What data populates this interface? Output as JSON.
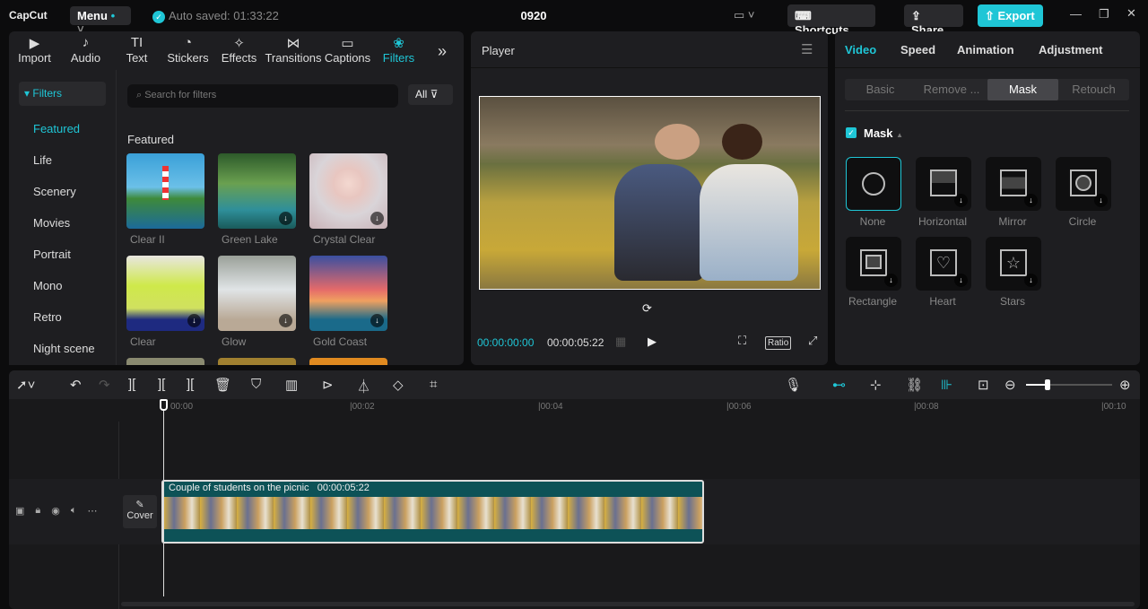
{
  "topbar": {
    "logo": "CapCut",
    "menu": "Menu",
    "autosave": "Auto saved: 01:33:22",
    "project": "0920",
    "shortcuts": "Shortcuts",
    "share": "Share",
    "export": "Export"
  },
  "media_tabs": [
    {
      "label": "Import",
      "icon": "▶"
    },
    {
      "label": "Audio",
      "icon": "♪"
    },
    {
      "label": "Text",
      "icon": "TI"
    },
    {
      "label": "Stickers",
      "icon": "◔"
    },
    {
      "label": "Effects",
      "icon": "✧"
    },
    {
      "label": "Transitions",
      "icon": "⋈"
    },
    {
      "label": "Captions",
      "icon": "▭"
    },
    {
      "label": "Filters",
      "icon": "❀"
    }
  ],
  "filters": {
    "header": "▾ Filters",
    "categories": [
      "Featured",
      "Life",
      "Scenery",
      "Movies",
      "Portrait",
      "Mono",
      "Retro",
      "Night scene"
    ],
    "search_placeholder": "Search for filters",
    "all": "All",
    "section": "Featured",
    "items": [
      "Clear II",
      "Green Lake",
      "Crystal Clear",
      "Clear",
      "Glow",
      "Gold Coast"
    ]
  },
  "player": {
    "title": "Player",
    "current": "00:00:00:00",
    "total": "00:00:05:22",
    "ratio": "Ratio"
  },
  "inspector": {
    "tabs": [
      "Video",
      "Speed",
      "Animation",
      "Adjustment"
    ],
    "subtabs": [
      "Basic",
      "Remove ...",
      "Mask",
      "Retouch"
    ],
    "mask_label": "Mask",
    "masks": [
      "None",
      "Horizontal",
      "Mirror",
      "Circle",
      "Rectangle",
      "Heart",
      "Stars"
    ]
  },
  "timeline": {
    "ticks": [
      "00:00",
      "|00:02",
      "|00:04",
      "|00:06",
      "|00:08",
      "|00:10"
    ],
    "clip_name": "Couple of students on the picnic",
    "clip_duration": "00:00:05:22",
    "cover": "Cover"
  },
  "colors": {
    "accent": "#1fc6d6",
    "clip": "#0d5257"
  }
}
